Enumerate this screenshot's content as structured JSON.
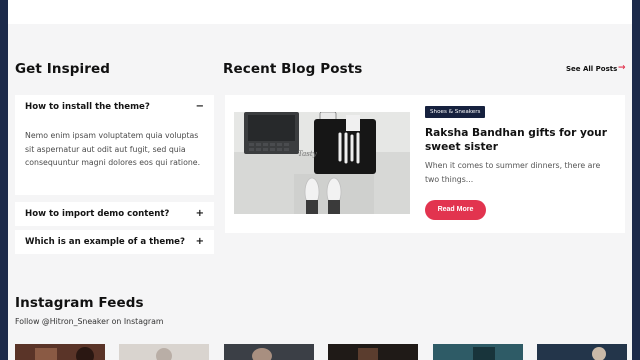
{
  "get_inspired": {
    "title": "Get Inspired",
    "faqs": [
      {
        "question": "How to install the theme?",
        "toggle": "−",
        "answer": "Nemo enim ipsam voluptatem quia voluptas sit aspernatur aut odit aut fugit, sed quia consequuntur magni dolores eos qui ratione.",
        "expanded": true
      },
      {
        "question": "How to import demo content?",
        "toggle": "+",
        "expanded": false
      },
      {
        "question": "Which is an example of a theme?",
        "toggle": "+",
        "expanded": false
      }
    ]
  },
  "recent_posts": {
    "title": "Recent Blog Posts",
    "see_all_label": "See All Posts",
    "see_all_arrow": "→",
    "post": {
      "tag": "Shoes & Sneakers",
      "title": "Raksha Bandhan gifts for your sweet sister",
      "excerpt": "When it comes to summer dinners, there are two things...",
      "read_more_label": "Read More",
      "image_text": "Tasty"
    }
  },
  "instagram": {
    "title": "Instagram Feeds",
    "subtitle": "Follow @Hitron_Sneaker on Instagram"
  },
  "colors": {
    "accent": "#e2344f",
    "tag_bg": "#16213e",
    "frame": "#1c2a4a"
  }
}
